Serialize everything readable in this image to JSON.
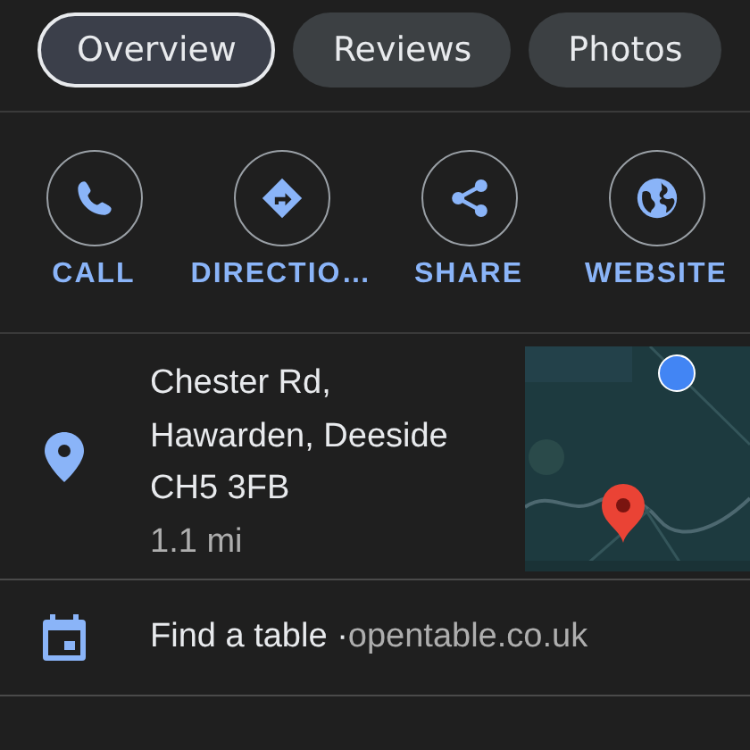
{
  "tabs": [
    {
      "label": "Overview",
      "selected": true
    },
    {
      "label": "Reviews",
      "selected": false
    },
    {
      "label": "Photos",
      "selected": false
    }
  ],
  "actions": [
    {
      "kind": "call",
      "label": "CALL"
    },
    {
      "kind": "directions",
      "label": "DIRECTIO…"
    },
    {
      "kind": "share",
      "label": "SHARE"
    },
    {
      "kind": "website",
      "label": "WEBSITE"
    }
  ],
  "address": {
    "lines": [
      "Chester Rd,",
      "Hawarden, Deeside",
      "CH5 3FB"
    ],
    "distance": "1.1 mi",
    "map": {
      "kind": "picture"
    }
  },
  "booking": {
    "text": "Find a table",
    "separator": "·",
    "source": "opentable.co.uk"
  }
}
